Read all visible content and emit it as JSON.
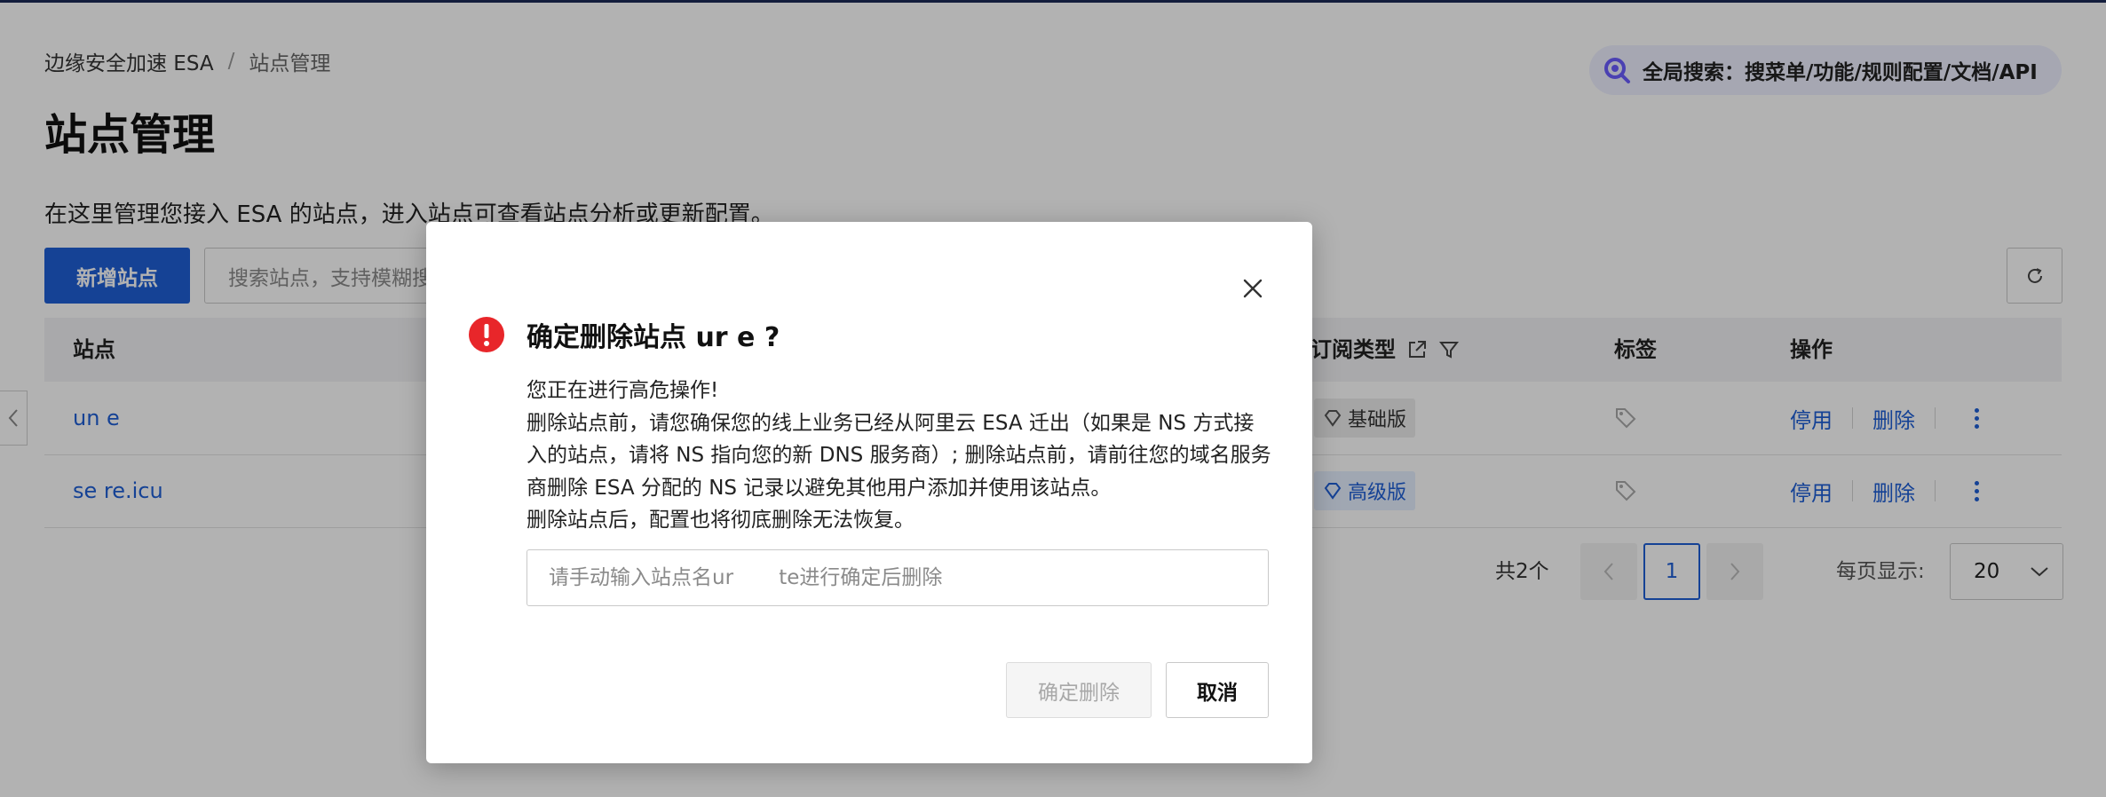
{
  "breadcrumb": {
    "root": "边缘安全加速 ESA",
    "separator": "/",
    "current": "站点管理"
  },
  "page": {
    "title": "站点管理",
    "description": "在这里管理您接入 ESA 的站点，进入站点可查看站点分析或更新配置。"
  },
  "global_search": {
    "label": "全局搜索：搜菜单/功能/规则配置/文档/API"
  },
  "toolbar": {
    "add_site_label": "新增站点",
    "search_placeholder": "搜索站点，支持模糊搜索"
  },
  "table": {
    "headers": {
      "site": "站点",
      "plan": "订阅类型",
      "tags": "标签",
      "actions": "操作"
    },
    "rows": [
      {
        "site": "un      e",
        "plan": "基础版",
        "disable": "停用",
        "delete": "删除"
      },
      {
        "site": "se       re.icu",
        "plan": "高级版",
        "disable": "停用",
        "delete": "删除"
      }
    ]
  },
  "pagination": {
    "total": "共2个",
    "current_page": "1",
    "page_size_label": "每页显示:",
    "page_size": "20"
  },
  "modal": {
    "title": "确定删除站点 ur       e ?",
    "lines": [
      "您正在进行高危操作!",
      "删除站点前，请您确保您的线上业务已经从阿里云 ESA 迁出（如果是 NS 方式接入的站点，请将 NS 指向您的新 DNS 服务商）; 删除站点前，请前往您的域名服务商删除 ESA 分配的 NS 记录以避免其他用户添加并使用该站点。",
      "删除站点后，配置也将彻底删除无法恢复。"
    ],
    "input_placeholder": "请手动输入站点名ur       te进行确定后删除",
    "confirm_label": "确定删除",
    "cancel_label": "取消"
  },
  "colors": {
    "primary": "#1f5fd6",
    "danger": "#e8262a"
  }
}
